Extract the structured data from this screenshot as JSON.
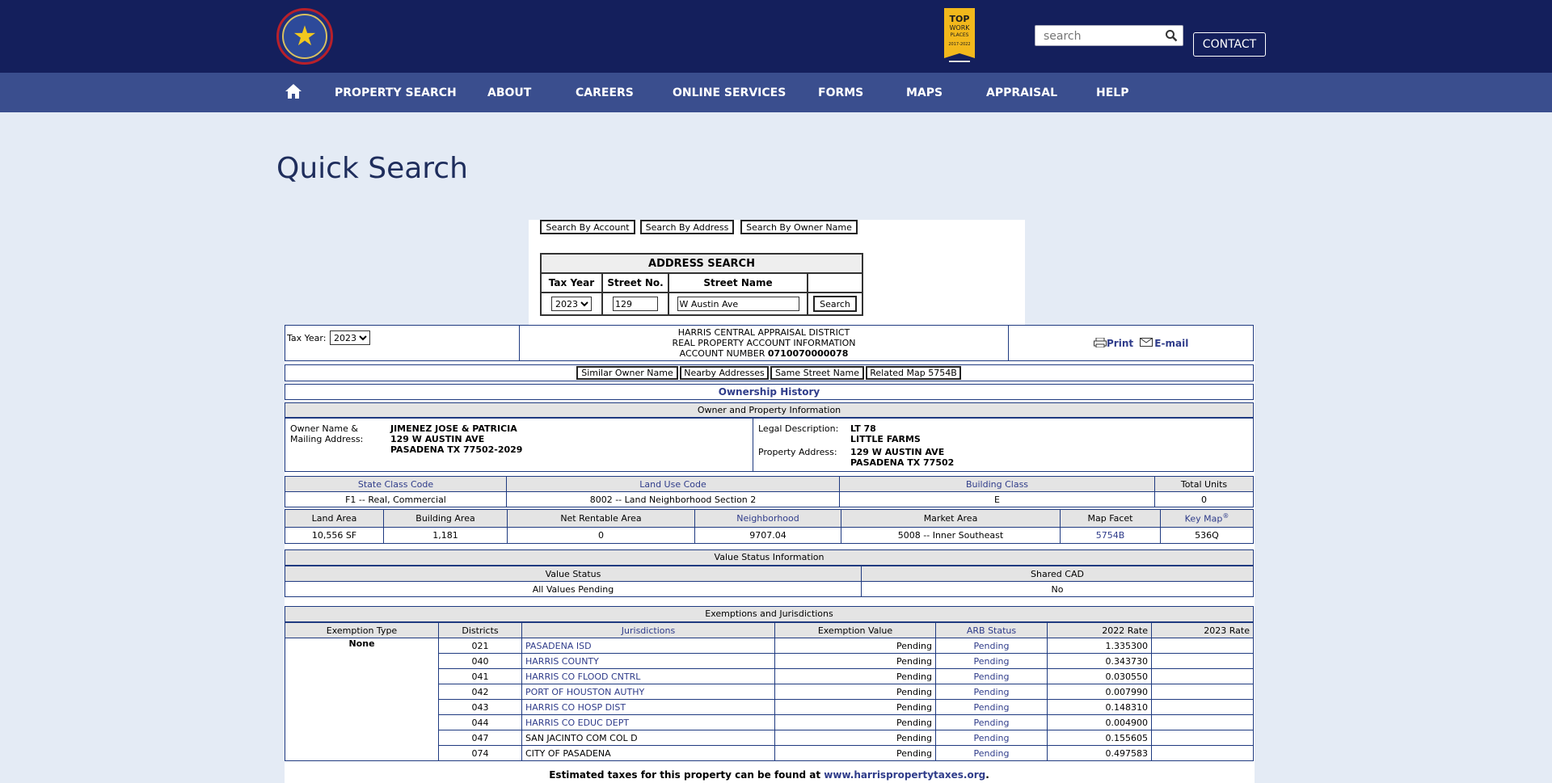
{
  "header": {
    "logo_text": "HARRIS COUNTY APPRAISAL DISTRICT",
    "badge_text": "TOP WORK PLACES 2017-2022",
    "search_placeholder": "search",
    "contact_label": "CONTACT"
  },
  "nav": {
    "items": [
      "PROPERTY SEARCH",
      "ABOUT",
      "CAREERS",
      "ONLINE SERVICES",
      "FORMS",
      "MAPS",
      "APPRAISAL",
      "HELP"
    ]
  },
  "page_title": "Quick Search",
  "search_tabs": [
    "Search By Account",
    "Search By Address",
    "Search By Owner Name"
  ],
  "address_search": {
    "heading": "ADDRESS SEARCH",
    "col_tax_year": "Tax Year",
    "col_street_no": "Street No.",
    "col_street_name": "Street Name",
    "tax_year": "2023",
    "street_no": "129",
    "street_name": "W Austin Ave",
    "search_label": "Search"
  },
  "result": {
    "tax_year_label": "Tax Year:",
    "tax_year": "2023",
    "district_line1": "HARRIS CENTRAL APPRAISAL DISTRICT",
    "district_line2": "REAL PROPERTY ACCOUNT INFORMATION",
    "account_label": "ACCOUNT NUMBER",
    "account_number": "0710070000078",
    "print_label": "Print",
    "email_label": "E-mail",
    "tabs": [
      "Similar Owner Name",
      "Nearby Addresses",
      "Same Street Name",
      "Related Map 5754B"
    ],
    "ownership_history": "Ownership History",
    "owner_section": "Owner and Property Information",
    "owner_label_1": "Owner Name &",
    "owner_label_2": "Mailing Address:",
    "owner_name": "JIMENEZ JOSE & PATRICIA",
    "owner_addr1": "129 W AUSTIN AVE",
    "owner_addr2": "PASADENA TX 77502-2029",
    "legal_label": "Legal Description:",
    "legal_1": "LT 78",
    "legal_2": "LITTLE FARMS",
    "prop_addr_label": "Property Address:",
    "prop_addr1": "129 W AUSTIN AVE",
    "prop_addr2": "PASADENA TX 77502",
    "row1_headers": [
      "State Class Code",
      "Land Use Code",
      "Building Class",
      "Total Units"
    ],
    "row1_values": [
      "F1 -- Real, Commercial",
      "8002 -- Land Neighborhood Section 2",
      "E",
      "0"
    ],
    "row2_headers": [
      "Land Area",
      "Building Area",
      "Net Rentable Area",
      "Neighborhood",
      "Market Area",
      "Map Facet",
      "Key Map"
    ],
    "key_map_sup": "®",
    "row2_values": [
      "10,556 SF",
      "1,181",
      "0",
      "9707.04",
      "5008 -- Inner Southeast",
      "5754B",
      "536Q"
    ],
    "value_section": "Value Status Information",
    "value_status_label": "Value Status",
    "shared_cad_label": "Shared CAD",
    "value_status": "All Values Pending",
    "shared_cad": "No",
    "exemptions_section": "Exemptions and Jurisdictions",
    "ex_headers": [
      "Exemption Type",
      "Districts",
      "Jurisdictions",
      "Exemption Value",
      "ARB Status",
      "2022 Rate",
      "2023 Rate"
    ],
    "exemption_type": "None",
    "jurisdictions": [
      {
        "district": "021",
        "name": "PASADENA ISD",
        "value": "Pending",
        "arb": "Pending",
        "rate": "1.335300",
        "link": true
      },
      {
        "district": "040",
        "name": "HARRIS COUNTY",
        "value": "Pending",
        "arb": "Pending",
        "rate": "0.343730",
        "link": true
      },
      {
        "district": "041",
        "name": "HARRIS CO FLOOD CNTRL",
        "value": "Pending",
        "arb": "Pending",
        "rate": "0.030550",
        "link": true
      },
      {
        "district": "042",
        "name": "PORT OF HOUSTON AUTHY",
        "value": "Pending",
        "arb": "Pending",
        "rate": "0.007990",
        "link": true
      },
      {
        "district": "043",
        "name": "HARRIS CO HOSP DIST",
        "value": "Pending",
        "arb": "Pending",
        "rate": "0.148310",
        "link": true
      },
      {
        "district": "044",
        "name": "HARRIS CO EDUC DEPT",
        "value": "Pending",
        "arb": "Pending",
        "rate": "0.004900",
        "link": true
      },
      {
        "district": "047",
        "name": "SAN JACINTO COM COL D",
        "value": "Pending",
        "arb": "Pending",
        "rate": "0.155605",
        "link": false
      },
      {
        "district": "074",
        "name": "CITY OF PASADENA",
        "value": "Pending",
        "arb": "Pending",
        "rate": "0.497583",
        "link": false
      }
    ],
    "estimated_taxes_text": "Estimated taxes for this property can be found at",
    "estimated_taxes_link": "www.harrispropertytaxes.org",
    "estimated_taxes_end": "."
  },
  "colors": {
    "header_bg": "#141f5c",
    "nav_bg": "#3a4e8e",
    "page_bg": "#e4ebf5",
    "link": "#2f3c8a",
    "border": "#1f3a80"
  }
}
